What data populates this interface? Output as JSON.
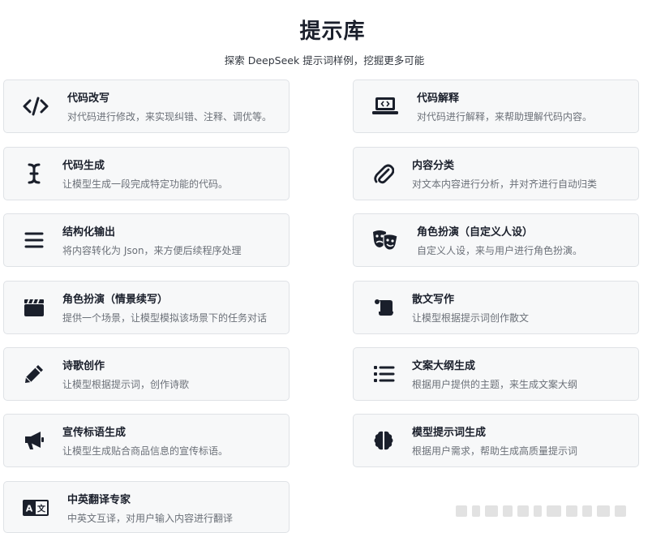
{
  "page": {
    "title": "提示库",
    "subtitle": "探索 DeepSeek 提示词样例，挖掘更多可能"
  },
  "cards": [
    {
      "title": "代码改写",
      "desc": "对代码进行修改，来实现纠错、注释、调优等。",
      "icon": "code-icon"
    },
    {
      "title": "代码解释",
      "desc": "对代码进行解释，来帮助理解代码内容。",
      "icon": "laptop-code-icon"
    },
    {
      "title": "代码生成",
      "desc": "让模型生成一段完成特定功能的代码。",
      "icon": "text-cursor-icon"
    },
    {
      "title": "内容分类",
      "desc": "对文本内容进行分析，并对齐进行自动归类",
      "icon": "paperclip-icon"
    },
    {
      "title": "结构化输出",
      "desc": "将内容转化为 Json，来方便后续程序处理",
      "icon": "menu-bars-icon"
    },
    {
      "title": "角色扮演（自定义人设）",
      "desc": "自定义人设，来与用户进行角色扮演。",
      "icon": "theater-masks-icon"
    },
    {
      "title": "角色扮演（情景续写）",
      "desc": "提供一个场景，让模型模拟该场景下的任务对话",
      "icon": "clapperboard-icon"
    },
    {
      "title": "散文写作",
      "desc": "让模型根据提示词创作散文",
      "icon": "scroll-icon"
    },
    {
      "title": "诗歌创作",
      "desc": "让模型根据提示词，创作诗歌",
      "icon": "pencil-icon"
    },
    {
      "title": "文案大纲生成",
      "desc": "根据用户提供的主题，来生成文案大纲",
      "icon": "list-icon"
    },
    {
      "title": "宣传标语生成",
      "desc": "让模型生成贴合商品信息的宣传标语。",
      "icon": "megaphone-icon"
    },
    {
      "title": "模型提示词生成",
      "desc": "根据用户需求，帮助生成高质量提示词",
      "icon": "brain-icon"
    },
    {
      "title": "中英翻译专家",
      "desc": "中英文互译，对用户输入内容进行翻译",
      "icon": "translate-icon"
    }
  ],
  "colors": {
    "icon": "#1a1f2b",
    "card_bg": "#f7f8f9",
    "card_border": "#dfe2e6",
    "desc_text": "#6b7078"
  }
}
